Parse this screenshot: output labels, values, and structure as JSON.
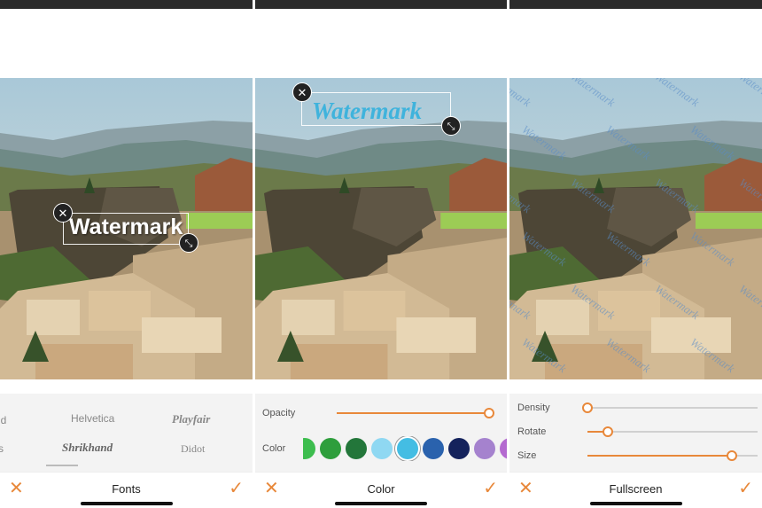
{
  "watermark_text": "Watermark",
  "accent_color": "#e8883a",
  "icons": {
    "cancel": "close-icon",
    "confirm": "checkmark-icon",
    "remove": "close-icon",
    "resize": "resize-icon"
  },
  "fonts_panel": {
    "font_options": [
      "ld",
      "Helvetica",
      "Playfair",
      "s",
      "Shrikhand",
      "Didot"
    ],
    "selected_font": "Shrikhand",
    "title": "Fonts",
    "cancel_glyph": "✕",
    "confirm_glyph": "✓"
  },
  "color_panel": {
    "opacity_label": "Opacity",
    "opacity_value": 1.0,
    "color_label": "Color",
    "swatches": [
      "#3dbd4e",
      "#2e9e3c",
      "#23763a",
      "#8fd8f2",
      "#44bde3",
      "#2a62ad",
      "#14225c",
      "#a582ce",
      "#b46ad0"
    ],
    "selected_color": "#44bde3",
    "title": "Color",
    "cancel_glyph": "✕",
    "confirm_glyph": "✓"
  },
  "fullscreen_panel": {
    "density_label": "Density",
    "density_value": 0.0,
    "rotate_label": "Rotate",
    "rotate_value": 0.12,
    "size_label": "Size",
    "size_value": 0.85,
    "title": "Fullscreen",
    "cancel_glyph": "✕",
    "confirm_glyph": "✓"
  }
}
